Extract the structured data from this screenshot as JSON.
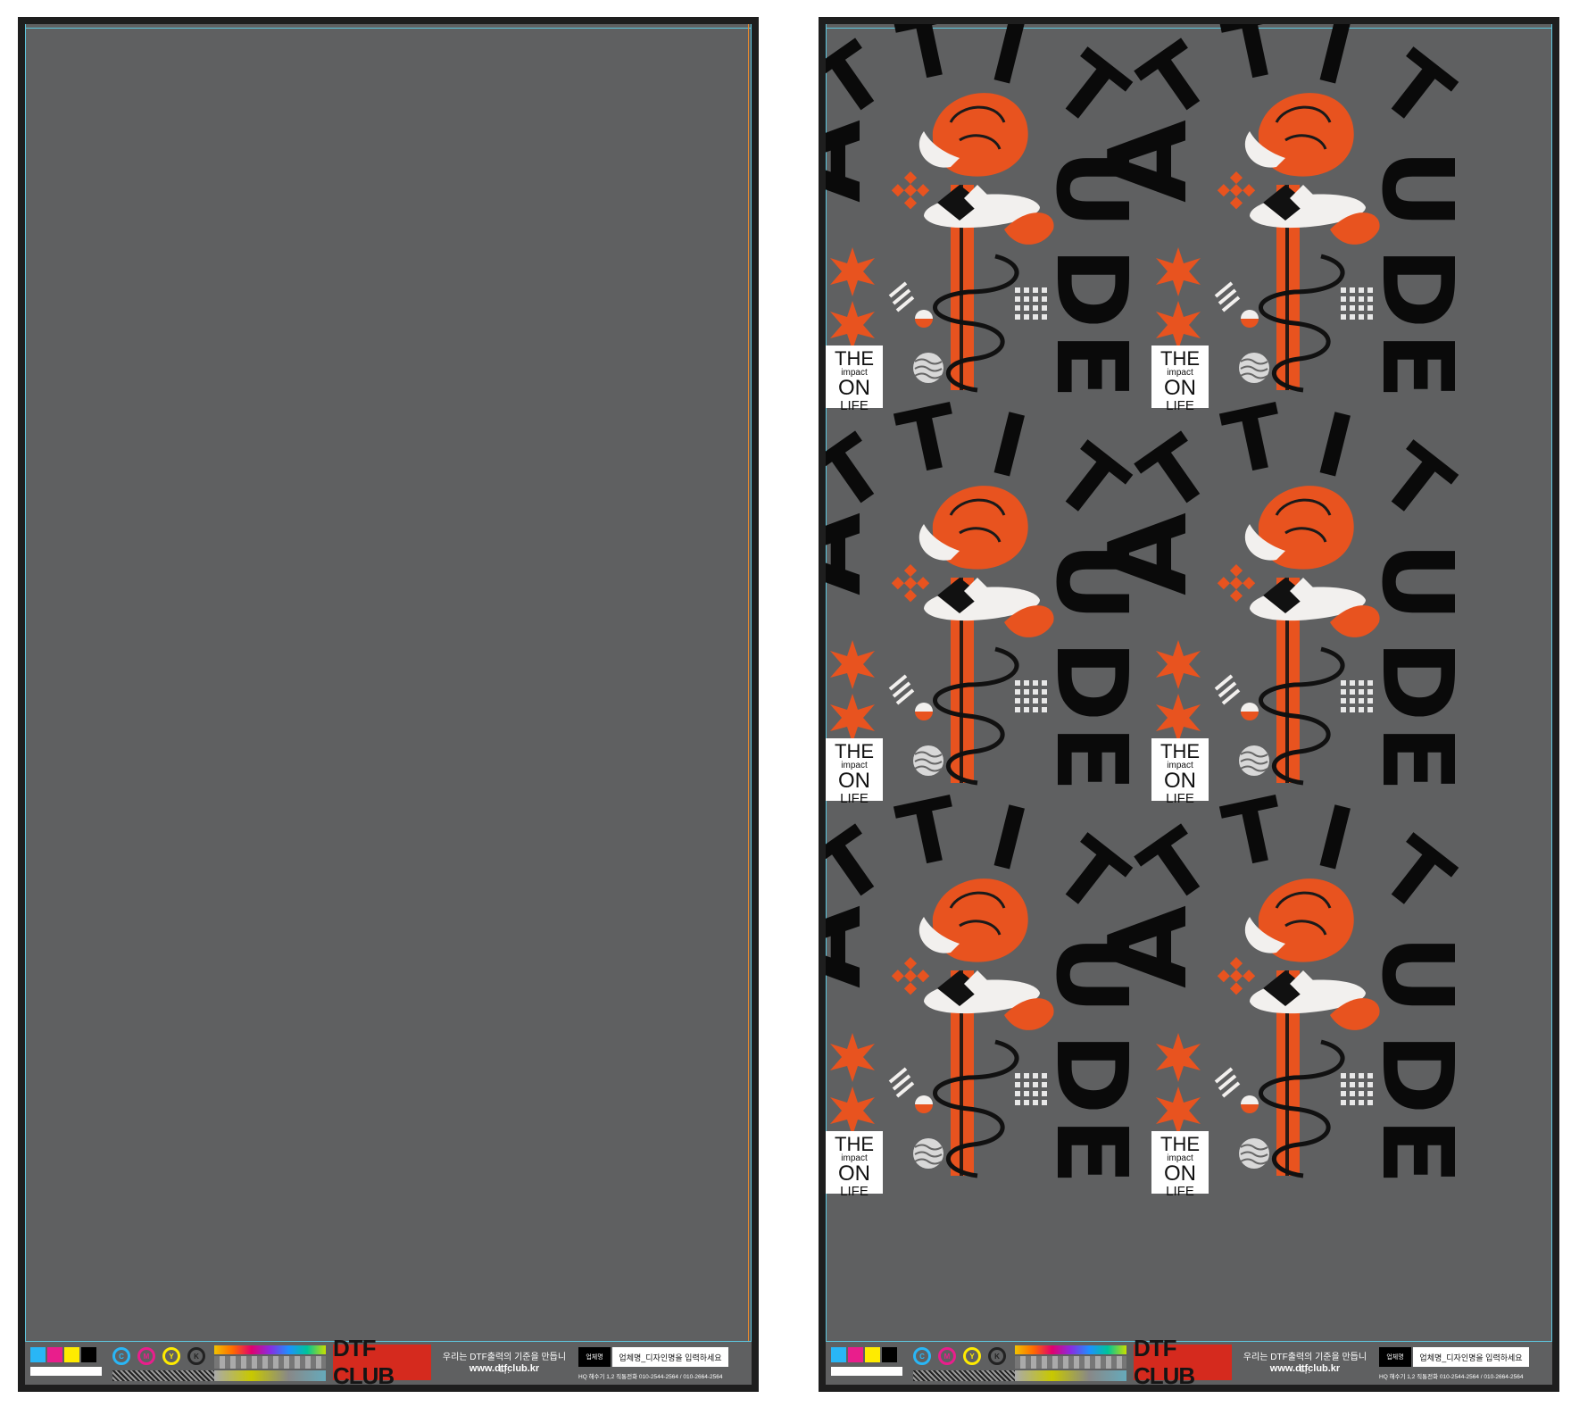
{
  "colors": {
    "canvas": "#5f6061",
    "sheet_border": "#1e1e1e",
    "guide": "#5ec8e0",
    "accent_orange": "#e8531f",
    "logo_red": "#d52a1e"
  },
  "artwork": {
    "letters": [
      "A",
      "T",
      "T",
      "I",
      "T",
      "U",
      "D",
      "E"
    ],
    "badge": {
      "line1": "THE",
      "line2": "impact",
      "line3": "ON",
      "line4": "LIFE"
    }
  },
  "footer": {
    "logo": "DTF CLUB",
    "slogan": "우리는 DTF출력의 기준을 만듭니다.",
    "url": "www.dtfclub.kr",
    "client_label": "업체명",
    "client_placeholder": "업체명_디자인명을 입력하세요",
    "contact": "HQ 해수기 1,2 직통전화 010-2544-2564 / 010-2664-2564",
    "ring_labels": [
      "C",
      "M",
      "Y",
      "K"
    ]
  }
}
